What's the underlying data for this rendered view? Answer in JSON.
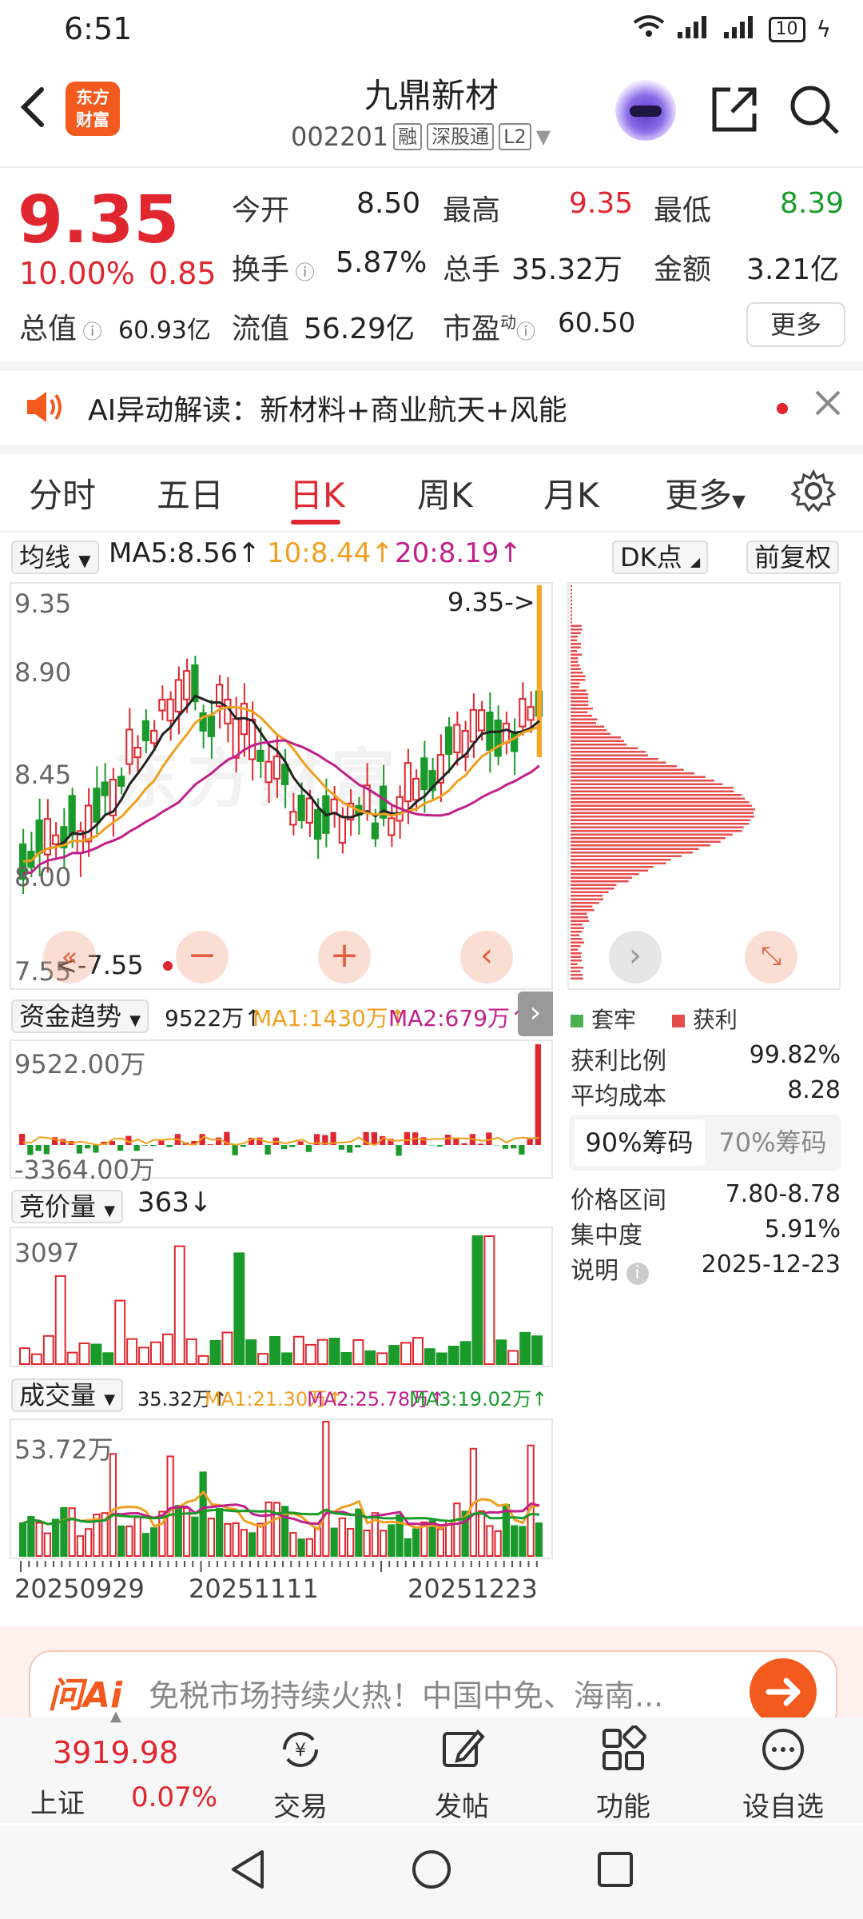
{
  "status": {
    "time": "6:51",
    "network": "⁴ᴳ",
    "network2": "⁴ᴳ",
    "battery": "10"
  },
  "header": {
    "logo_text": "东方\n财富",
    "stock_name": "九鼎新材",
    "stock_code": "002201",
    "tags": [
      "融",
      "深股通",
      "L2"
    ]
  },
  "quote": {
    "price": "9.35",
    "change_pct": "10.00%",
    "change": "0.85",
    "open_label": "今开",
    "open": "8.50",
    "high_label": "最高",
    "high": "9.35",
    "low_label": "最低",
    "low": "8.39",
    "turnover_label": "换手",
    "turnover": "5.87%",
    "volume_label": "总手",
    "volume": "35.32万",
    "amount_label": "金额",
    "amount": "3.21亿",
    "mcap_label": "总值",
    "mcap": "60.93亿",
    "float_label": "流值",
    "float": "56.29亿",
    "pe_label": "市盈",
    "pe_sup": "动",
    "pe": "60.50",
    "more": "更多"
  },
  "ai_banner": {
    "text": "AI异动解读：新材料+商业航天+风能"
  },
  "tabs": [
    "分时",
    "五日",
    "日K",
    "周K",
    "月K",
    "更多"
  ],
  "active_tab": "日K",
  "ma": {
    "selector": "均线",
    "ma5": "MA5:8.56↑",
    "ma10": "10:8.44↑",
    "ma20": "20:8.19↑",
    "dk": "DK点",
    "adjust": "前复权",
    "colors": {
      "ma5": "#222222",
      "ma10": "#f0a020",
      "ma20": "#c0208a"
    }
  },
  "kchart": {
    "y_labels": [
      "9.35",
      "8.90",
      "8.45",
      "8.00",
      "7.55"
    ],
    "max_label": "9.35->",
    "min_label": "<-7.55",
    "watermark": "东方财富"
  },
  "fund": {
    "selector": "资金趋势",
    "value": "9522万↑",
    "ma1": "MA1:1430万↑",
    "ma2": "MA2:679万↑",
    "top_label": "9522.00万",
    "bottom_label": "-3364.00万"
  },
  "auction": {
    "selector": "竞价量",
    "value": "363↓",
    "top_label": "3097"
  },
  "volume": {
    "selector": "成交量",
    "value": "35.32万↑",
    "ma1": "MA1:21.30万↑",
    "ma2": "MA2:25.78万↑",
    "ma3": "MA3:19.02万↑",
    "top_label": "53.72万",
    "dates": [
      "20250929",
      "20251111",
      "20251223"
    ]
  },
  "chips": {
    "legend": [
      "套牢",
      "获利"
    ],
    "rows": [
      {
        "label": "获利比例",
        "value": "99.82%"
      },
      {
        "label": "平均成本",
        "value": "8.28"
      }
    ],
    "tabs": [
      "90%筹码",
      "70%筹码"
    ],
    "rows2": [
      {
        "label": "价格区间",
        "value": "7.80-8.78"
      },
      {
        "label": "集中度",
        "value": "5.91%"
      },
      {
        "label": "说明",
        "value": "2025-12-23"
      }
    ]
  },
  "ask_ai": {
    "brand": "问Ai",
    "text": "免税市场持续火热！中国中免、海南..."
  },
  "bottom": {
    "index_value": "3919.98",
    "index_name": "上证",
    "index_pct": "0.07%",
    "nav": [
      "交易",
      "发帖",
      "功能",
      "设自选"
    ]
  }
}
